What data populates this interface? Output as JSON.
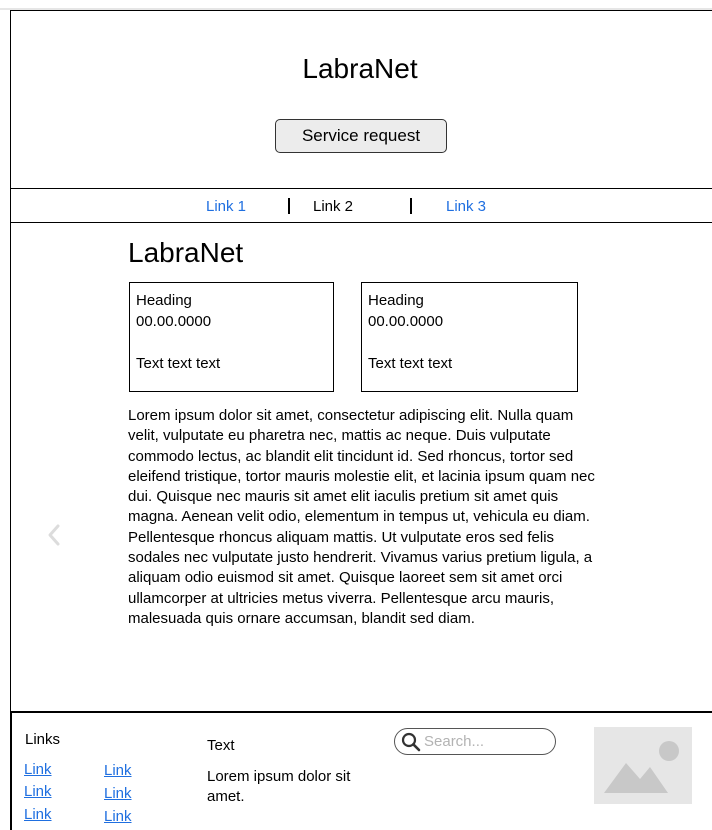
{
  "header": {
    "title": "LabraNet",
    "service_button": "Service request"
  },
  "nav": {
    "links": [
      "Link 1",
      "Link 2",
      "Link 3"
    ],
    "active_index": 1
  },
  "main": {
    "title": "LabraNet",
    "cards": [
      {
        "heading": "Heading",
        "date": "00.00.0000",
        "text": "Text text text"
      },
      {
        "heading": "Heading",
        "date": "00.00.0000",
        "text": "Text text text"
      }
    ],
    "body": "Lorem ipsum dolor sit amet, consectetur adipiscing elit. Nulla quam velit, vulputate eu pharetra nec, mattis ac neque. Duis vulputate commodo lectus, ac blandit elit tincidunt id. Sed rhoncus, tortor sed eleifend tristique, tortor mauris molestie elit, et lacinia ipsum quam nec dui. Quisque nec mauris sit amet elit iaculis pretium sit amet quis magna. Aenean velit odio, elementum in tempus ut, vehicula eu diam. Pellentesque rhoncus aliquam mattis. Ut vulputate eros sed felis sodales nec vulputate justo hendrerit. Vivamus varius pretium ligula, a aliquam odio euismod sit amet. Quisque laoreet sem sit amet orci ullamcorper at ultricies metus viverra. Pellentesque arcu mauris, malesuada quis ornare accumsan, blandit sed diam.",
    "prev_icon": "chevron-left-icon"
  },
  "footer": {
    "links_heading": "Links",
    "links_col1": [
      "Link",
      "Link",
      "Link"
    ],
    "links_col2": [
      "Link",
      "Link",
      "Link"
    ],
    "text_heading": "Text",
    "text_body": "Lorem ipsum dolor sit amet.",
    "search": {
      "placeholder": "Search...",
      "icon": "search-icon"
    },
    "image_icon": "image-placeholder-icon"
  },
  "colors": {
    "link": "#1f6fe0",
    "button_bg": "#ececec",
    "placeholder_bg": "#e6e6e6",
    "placeholder_fg": "#c8c8c8"
  }
}
